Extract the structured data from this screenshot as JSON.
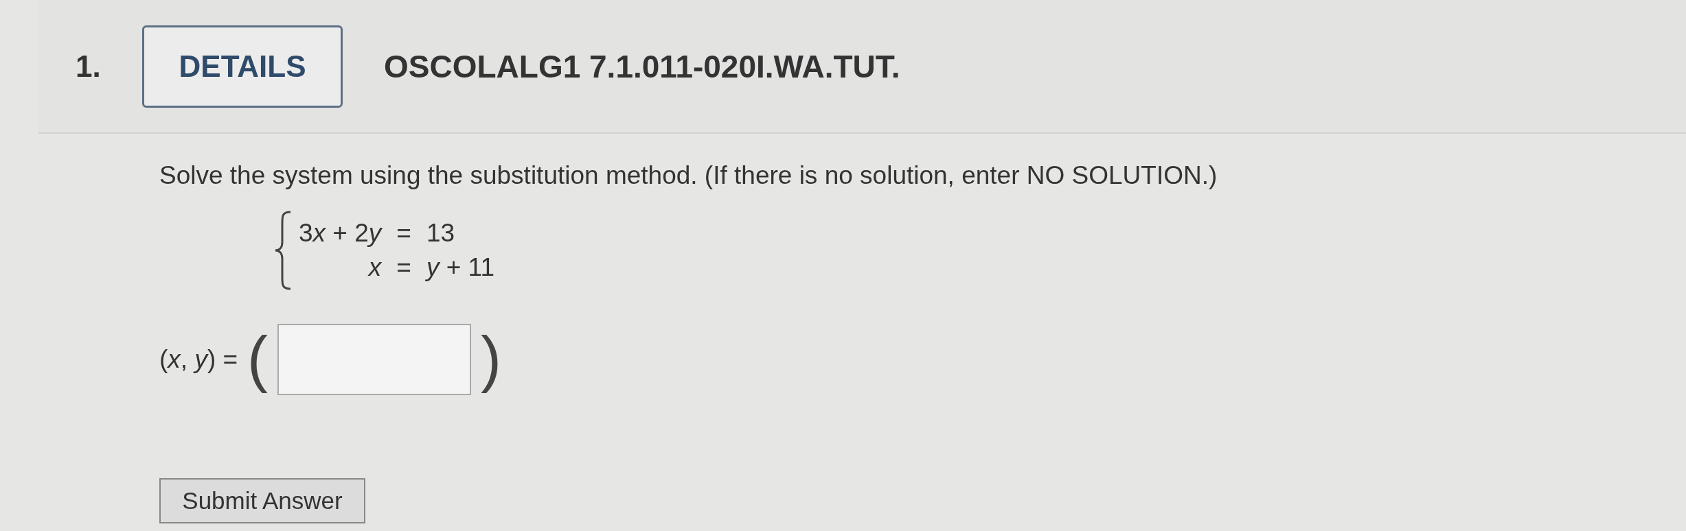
{
  "question": {
    "number": "1.",
    "details_button": "DETAILS",
    "code": "OSCOLALG1 7.1.011-020I.WA.TUT."
  },
  "prompt": "Solve the system using the substitution method. (If there is no solution, enter NO SOLUTION.)",
  "equations": [
    {
      "left": [
        {
          "text": "3",
          "italic": false
        },
        {
          "text": "x",
          "italic": true
        },
        {
          "text": " + 2",
          "italic": false
        },
        {
          "text": "y",
          "italic": true
        }
      ],
      "equals": "=",
      "right": [
        {
          "text": "13",
          "italic": false
        }
      ]
    },
    {
      "left": [
        {
          "text": "x",
          "italic": true
        }
      ],
      "equals": "=",
      "right": [
        {
          "text": "y",
          "italic": true
        },
        {
          "text": " + 11",
          "italic": false
        }
      ]
    }
  ],
  "answer": {
    "label": "(*x*, *y*) =",
    "open": "(",
    "close": ")"
  },
  "submit": "Submit Answer"
}
